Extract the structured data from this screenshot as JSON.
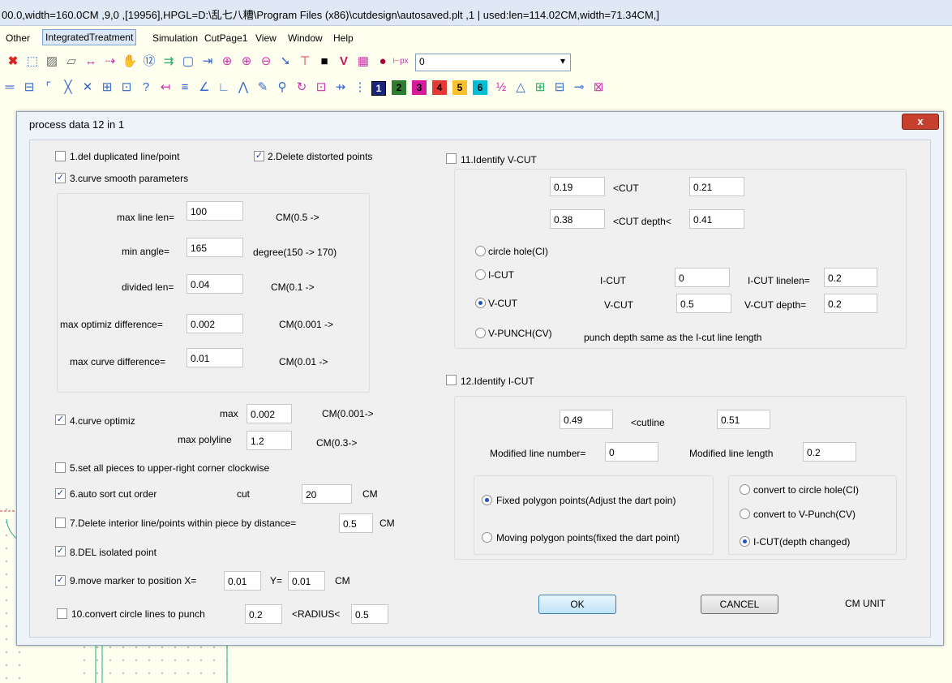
{
  "window": {
    "title": "00.0,width=160.0CM ,9,0 ,[19956],HPGL=D:\\乱七八糟\\Program Files (x86)\\cutdesign\\autosaved.plt ,1 | used:len=114.02CM,width=71.34CM,]"
  },
  "menu": [
    "Other",
    "IntegratedTreatment",
    "Simulation",
    "CutPage1",
    "View",
    "Window",
    "Help"
  ],
  "toolbar": {
    "px_combo_value": "0",
    "color_numbers": [
      "1",
      "2",
      "3",
      "4",
      "5",
      "6"
    ]
  },
  "dialog": {
    "title": "process data 12 in 1",
    "close": "x",
    "opt1": {
      "label": "1.del duplicated line/point",
      "checked": false
    },
    "opt2": {
      "label": "2.Delete distorted points",
      "checked": true
    },
    "opt3": {
      "label": "3.curve smooth parameters",
      "checked": true
    },
    "smooth": {
      "max_line_len_label": "max line len=",
      "max_line_len": "100",
      "max_line_len_unit": "CM(0.5 ->",
      "min_angle_label": "min angle=",
      "min_angle": "165",
      "min_angle_unit": "degree(150 -> 170)",
      "divided_len_label": "divided len=",
      "divided_len": "0.04",
      "divided_len_unit": "CM(0.1 ->",
      "max_optimiz_label": "max optimiz difference=",
      "max_optimiz": "0.002",
      "max_optimiz_unit": "CM(0.001 ->",
      "max_curve_label": "max curve difference=",
      "max_curve": "0.01",
      "max_curve_unit": "CM(0.01 ->"
    },
    "opt4": {
      "label": "4.curve optimiz",
      "checked": true,
      "max_label": "max",
      "max": "0.002",
      "max_unit": "CM(0.001->",
      "polyline_label": "max polyline",
      "polyline": "1.2",
      "polyline_unit": "CM(0.3->"
    },
    "opt5": {
      "label": "5.set all pieces to upper-right corner clockwise",
      "checked": false
    },
    "opt6": {
      "label": "6.auto sort cut order",
      "checked": true,
      "cut_label": "cut",
      "cut": "20",
      "unit": "CM"
    },
    "opt7": {
      "label": "7.Delete interior line/points within piece by distance=",
      "checked": false,
      "value": "0.5",
      "unit": "CM"
    },
    "opt8": {
      "label": "8.DEL isolated point",
      "checked": true
    },
    "opt9": {
      "label": "9.move marker to position X=",
      "checked": true,
      "x": "0.01",
      "y_label": "Y=",
      "y": "0.01",
      "unit": "CM"
    },
    "opt10": {
      "label": "10.convert circle lines to punch",
      "checked": false,
      "v1": "0.2",
      "radius_label": "<RADIUS<",
      "v2": "0.5"
    },
    "opt11": {
      "label": "11.Identify V-CUT",
      "checked": false,
      "cut_min": "0.19",
      "cut_label": "<CUT",
      "cut_max": "0.21",
      "depth_min": "0.38",
      "depth_label": "<CUT depth<",
      "depth_max": "0.41",
      "r_circle": "circle hole(CI)",
      "r_icut": "I-CUT",
      "icut_label": "I-CUT",
      "icut": "0",
      "icut_linelen_label": "I-CUT linelen=",
      "icut_linelen": "0.2",
      "r_vcut": "V-CUT",
      "vcut_label": "V-CUT",
      "vcut": "0.5",
      "vcut_depth_label": "V-CUT depth=",
      "vcut_depth": "0.2",
      "r_vpunch": "V-PUNCH(CV)",
      "punch_note": "punch depth  same as the I-cut line length",
      "selected": "V-CUT"
    },
    "opt12": {
      "label": "12.Identify I-CUT",
      "checked": false,
      "min": "0.49",
      "cutline_label": "<cutline",
      "max": "0.51",
      "mod_num_label": "Modified line number=",
      "mod_num": "0",
      "mod_len_label": "Modified line length",
      "mod_len": "0.2",
      "r_fixed": "Fixed polygon points(Adjust the dart poin)",
      "r_moving": "Moving polygon points(fixed the dart point)",
      "r_circle": "convert to circle hole(CI)",
      "r_vpunch": "convert to V-Punch(CV)",
      "r_icut": "I-CUT(depth changed)"
    },
    "ok": "OK",
    "cancel": "CANCEL",
    "unit": "CM UNIT"
  }
}
